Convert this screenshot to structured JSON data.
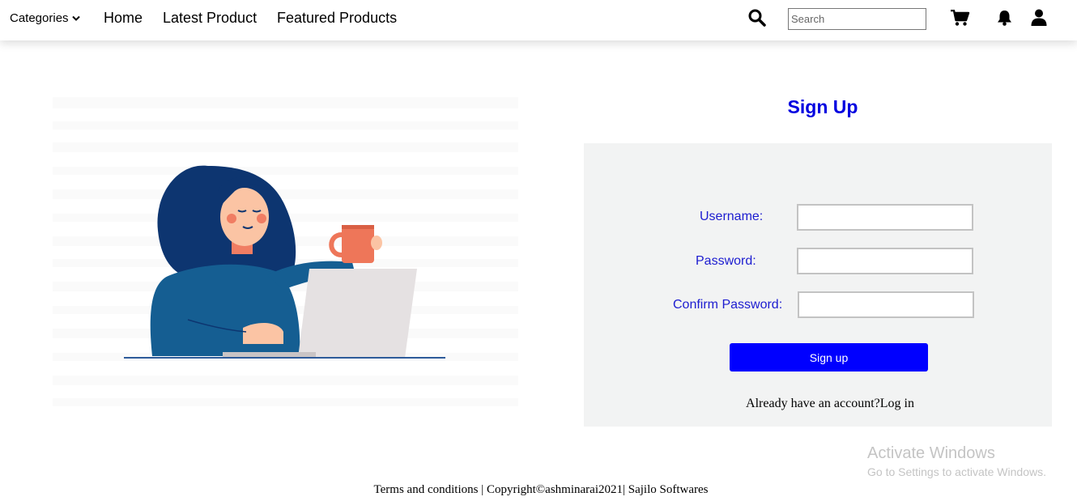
{
  "nav": {
    "categories_label": "Categories",
    "links": [
      "Home",
      "Latest Product",
      "Featured Products"
    ],
    "search_placeholder": "Search"
  },
  "signup": {
    "title": "Sign Up",
    "username_label": "Username:",
    "password_label": "Password:",
    "confirm_label": "Confirm Password:",
    "button_label": "Sign up",
    "login_prompt": "Already have an account?",
    "login_link": "Log in"
  },
  "watermark": {
    "title": "Activate Windows",
    "subtitle": "Go to Settings to activate Windows."
  },
  "footer": {
    "text": "Terms and conditions | Copyright©ashminarai2021| Sajilo Softwares"
  },
  "colors": {
    "accent": "#0000ff",
    "label_blue": "#1c1cd0",
    "panel_bg": "#f2f3f3"
  },
  "icons": [
    "chevron-down-icon",
    "search-icon",
    "cart-icon",
    "bell-icon",
    "user-icon"
  ]
}
